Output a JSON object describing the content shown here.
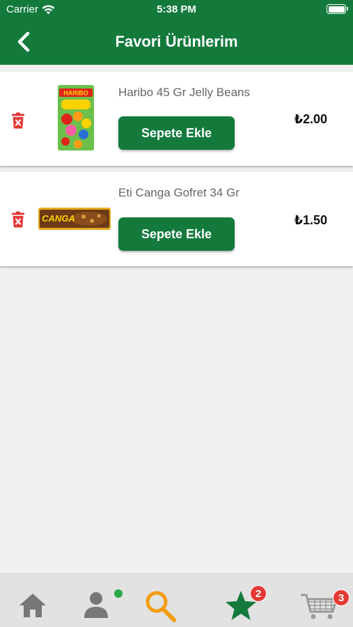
{
  "status_bar": {
    "carrier": "Carrier",
    "time": "5:38 PM"
  },
  "header": {
    "title": "Favori Ürünlerim",
    "back_icon": "chevron-left-icon"
  },
  "colors": {
    "primary": "#137a3c",
    "delete": "#e53935",
    "search_accent": "#f39c12",
    "badge": "#e53935"
  },
  "items": [
    {
      "name": "Haribo 45 Gr Jelly Beans",
      "add_label": "Sepete Ekle",
      "price": "₺2.00",
      "thumbnail_icon": "haribo-package-image"
    },
    {
      "name": "Eti Canga Gofret 34 Gr",
      "add_label": "Sepete Ekle",
      "price": "₺1.50",
      "thumbnail_icon": "canga-bar-image"
    }
  ],
  "tabbar": {
    "tabs": [
      {
        "icon": "home-icon"
      },
      {
        "icon": "profile-icon"
      },
      {
        "icon": "search-icon"
      },
      {
        "icon": "star-icon",
        "badge": "2"
      },
      {
        "icon": "cart-icon",
        "badge": "3"
      }
    ]
  }
}
